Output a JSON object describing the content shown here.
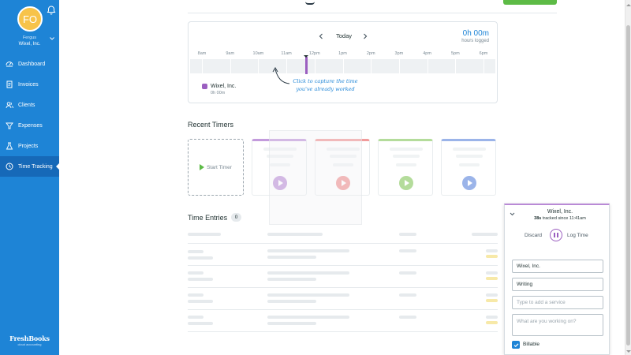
{
  "user": {
    "initials": "FO",
    "name": "Fergus",
    "company": "Wixel, Inc."
  },
  "nav": {
    "items": [
      {
        "label": "Dashboard",
        "icon": "dashboard-icon"
      },
      {
        "label": "Invoices",
        "icon": "invoice-icon"
      },
      {
        "label": "Clients",
        "icon": "clients-icon"
      },
      {
        "label": "Expenses",
        "icon": "expenses-icon"
      },
      {
        "label": "Projects",
        "icon": "projects-icon"
      },
      {
        "label": "Time Tracking",
        "icon": "clock-icon",
        "active": true
      }
    ]
  },
  "brand": {
    "logo": "FreshBooks",
    "tagline": "cloud accounting"
  },
  "timeline": {
    "day_label": "Today",
    "hours_logged_value": "0h 00m",
    "hours_logged_label": "hours logged",
    "ticks": [
      "8am",
      "9am",
      "10am",
      "11am",
      "12pm",
      "1pm",
      "2pm",
      "3pm",
      "4pm",
      "5pm",
      "6pm"
    ],
    "client_name": "Wixel, Inc.",
    "client_time": "0h 00m",
    "hint_line1": "Click to capture the time",
    "hint_line2": "you've already worked"
  },
  "recent_timers": {
    "title": "Recent Timers",
    "start_label": "Start Timer",
    "card_colors": [
      "#b98ad6",
      "#ef8a8a",
      "#a8d68a",
      "#8aa8e6"
    ]
  },
  "time_entries": {
    "title": "Time Entries",
    "count": "0"
  },
  "timer_popup": {
    "client": "Wixel, Inc.",
    "tracked_bold": "38s",
    "tracked_rest": "tracked since 11:41am",
    "discard_label": "Discard",
    "log_label": "Log Time",
    "client_value": "Wixel, Inc.",
    "project_value": "Writing",
    "service_placeholder": "Type to add a service",
    "notes_placeholder": "What are you working on?",
    "billable_label": "Billable"
  },
  "colors": {
    "sidebar": "#1e84d6",
    "accent": "#9b5fc0",
    "primary": "#5dbb46"
  }
}
